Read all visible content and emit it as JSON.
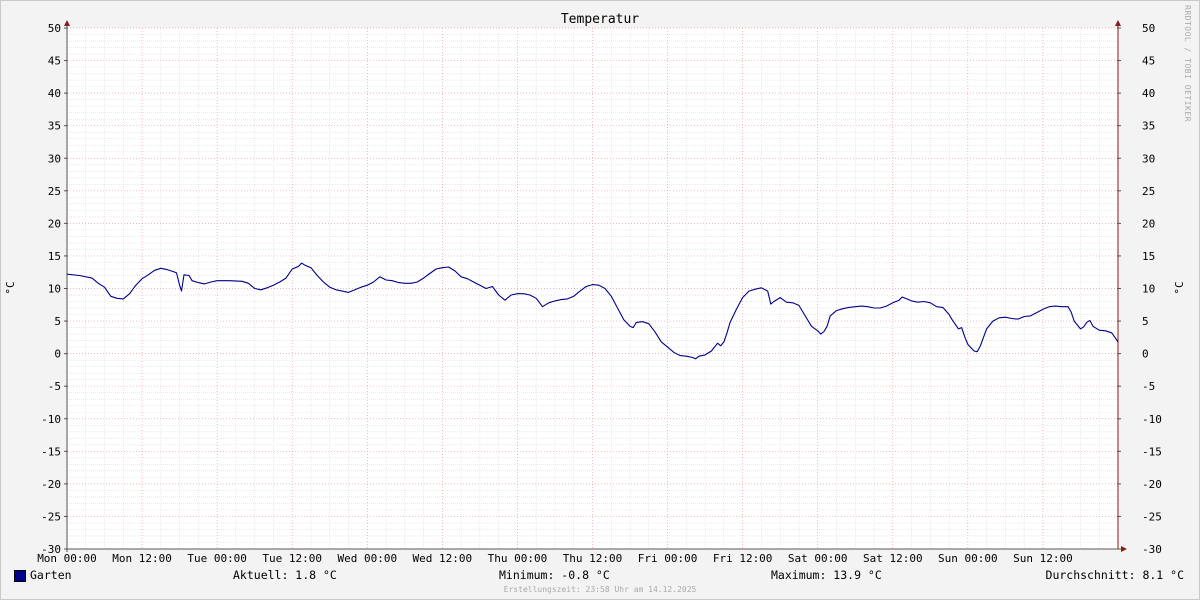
{
  "chart_data": {
    "type": "line",
    "title": "Temperatur",
    "ylabel": "°C",
    "ylabel_right": "°C",
    "ylim": [
      -30,
      50
    ],
    "yticks": [
      50,
      45,
      40,
      35,
      30,
      25,
      20,
      15,
      10,
      5,
      0,
      -5,
      -10,
      -15,
      -20,
      -25,
      -30
    ],
    "xlim": [
      0,
      168
    ],
    "x_unit": "hours since Mon 00:00",
    "xticks": [
      {
        "x": 0,
        "label": "Mon 00:00"
      },
      {
        "x": 12,
        "label": "Mon 12:00"
      },
      {
        "x": 24,
        "label": "Tue 00:00"
      },
      {
        "x": 36,
        "label": "Tue 12:00"
      },
      {
        "x": 48,
        "label": "Wed 00:00"
      },
      {
        "x": 60,
        "label": "Wed 12:00"
      },
      {
        "x": 72,
        "label": "Thu 00:00"
      },
      {
        "x": 84,
        "label": "Thu 12:00"
      },
      {
        "x": 96,
        "label": "Fri 00:00"
      },
      {
        "x": 108,
        "label": "Fri 12:00"
      },
      {
        "x": 120,
        "label": "Sat 00:00"
      },
      {
        "x": 132,
        "label": "Sat 12:00"
      },
      {
        "x": 144,
        "label": "Sun 00:00"
      },
      {
        "x": 156,
        "label": "Sun 12:00"
      }
    ],
    "grid": true,
    "legend_position": "bottom-left",
    "series": [
      {
        "name": "Garten",
        "color": "#00008b",
        "points": [
          [
            0,
            12.2
          ],
          [
            2,
            12.0
          ],
          [
            4,
            11.6
          ],
          [
            5,
            10.8
          ],
          [
            6,
            10.2
          ],
          [
            6.5,
            9.5
          ],
          [
            7,
            8.8
          ],
          [
            8,
            8.5
          ],
          [
            9,
            8.4
          ],
          [
            10,
            9.2
          ],
          [
            11,
            10.5
          ],
          [
            12,
            11.5
          ],
          [
            13,
            12.1
          ],
          [
            14,
            12.8
          ],
          [
            15,
            13.1
          ],
          [
            16,
            12.9
          ],
          [
            17,
            12.6
          ],
          [
            17.5,
            12.4
          ],
          [
            18,
            10.5
          ],
          [
            18.3,
            9.6
          ],
          [
            18.7,
            12.1
          ],
          [
            19.5,
            12.0
          ],
          [
            20,
            11.2
          ],
          [
            21,
            10.9
          ],
          [
            22,
            10.7
          ],
          [
            23,
            11.0
          ],
          [
            24,
            11.2
          ],
          [
            26,
            11.2
          ],
          [
            28,
            11.1
          ],
          [
            29,
            10.8
          ],
          [
            30,
            10.0
          ],
          [
            31,
            9.8
          ],
          [
            32,
            10.1
          ],
          [
            33,
            10.5
          ],
          [
            34,
            11.0
          ],
          [
            35,
            11.6
          ],
          [
            36,
            13.0
          ],
          [
            37,
            13.4
          ],
          [
            37.5,
            13.9
          ],
          [
            38,
            13.6
          ],
          [
            39,
            13.2
          ],
          [
            40,
            12.0
          ],
          [
            41,
            11.0
          ],
          [
            42,
            10.2
          ],
          [
            43,
            9.8
          ],
          [
            44,
            9.6
          ],
          [
            45,
            9.4
          ],
          [
            46,
            9.8
          ],
          [
            47,
            10.2
          ],
          [
            48,
            10.5
          ],
          [
            49,
            11.0
          ],
          [
            50,
            11.8
          ],
          [
            51,
            11.3
          ],
          [
            52,
            11.2
          ],
          [
            53,
            10.9
          ],
          [
            54,
            10.8
          ],
          [
            55,
            10.8
          ],
          [
            56,
            11.0
          ],
          [
            57,
            11.6
          ],
          [
            58,
            12.3
          ],
          [
            59,
            13.0
          ],
          [
            60,
            13.2
          ],
          [
            61,
            13.3
          ],
          [
            62,
            12.7
          ],
          [
            63,
            11.8
          ],
          [
            64,
            11.5
          ],
          [
            65,
            11.0
          ],
          [
            66,
            10.5
          ],
          [
            67,
            10.0
          ],
          [
            68,
            10.3
          ],
          [
            69,
            9.0
          ],
          [
            70,
            8.2
          ],
          [
            71,
            9.0
          ],
          [
            72,
            9.2
          ],
          [
            73,
            9.2
          ],
          [
            74,
            9.0
          ],
          [
            75,
            8.5
          ],
          [
            76,
            7.2
          ],
          [
            77,
            7.8
          ],
          [
            78,
            8.1
          ],
          [
            79,
            8.3
          ],
          [
            80,
            8.4
          ],
          [
            81,
            8.8
          ],
          [
            82,
            9.6
          ],
          [
            83,
            10.3
          ],
          [
            84,
            10.6
          ],
          [
            85,
            10.5
          ],
          [
            86,
            10.0
          ],
          [
            87,
            8.8
          ],
          [
            88,
            7.0
          ],
          [
            89,
            5.2
          ],
          [
            90,
            4.2
          ],
          [
            90.5,
            4.0
          ],
          [
            91,
            4.8
          ],
          [
            92,
            4.9
          ],
          [
            93,
            4.6
          ],
          [
            94,
            3.3
          ],
          [
            95,
            1.8
          ],
          [
            96,
            1.0
          ],
          [
            97,
            0.2
          ],
          [
            98,
            -0.3
          ],
          [
            99,
            -0.4
          ],
          [
            100,
            -0.6
          ],
          [
            100.5,
            -0.8
          ],
          [
            101,
            -0.4
          ],
          [
            102,
            -0.2
          ],
          [
            103,
            0.4
          ],
          [
            104,
            1.6
          ],
          [
            104.5,
            1.2
          ],
          [
            105,
            1.8
          ],
          [
            105.5,
            3.2
          ],
          [
            106,
            4.8
          ],
          [
            107,
            6.8
          ],
          [
            108,
            8.6
          ],
          [
            109,
            9.6
          ],
          [
            110,
            9.9
          ],
          [
            111,
            10.1
          ],
          [
            112,
            9.6
          ],
          [
            112.5,
            7.6
          ],
          [
            113,
            8.0
          ],
          [
            114,
            8.6
          ],
          [
            115,
            7.9
          ],
          [
            116,
            7.8
          ],
          [
            117,
            7.4
          ],
          [
            118,
            5.8
          ],
          [
            119,
            4.2
          ],
          [
            120,
            3.5
          ],
          [
            120.5,
            3.0
          ],
          [
            121,
            3.4
          ],
          [
            121.5,
            4.2
          ],
          [
            122,
            5.8
          ],
          [
            123,
            6.6
          ],
          [
            124,
            6.9
          ],
          [
            125,
            7.1
          ],
          [
            126,
            7.2
          ],
          [
            127,
            7.3
          ],
          [
            128,
            7.2
          ],
          [
            129,
            7.0
          ],
          [
            130,
            7.0
          ],
          [
            131,
            7.3
          ],
          [
            132,
            7.8
          ],
          [
            133,
            8.2
          ],
          [
            133.5,
            8.7
          ],
          [
            134,
            8.5
          ],
          [
            135,
            8.1
          ],
          [
            136,
            7.9
          ],
          [
            137,
            8.0
          ],
          [
            138,
            7.8
          ],
          [
            139,
            7.2
          ],
          [
            140,
            7.1
          ],
          [
            141,
            6.0
          ],
          [
            141.5,
            5.2
          ],
          [
            142,
            4.5
          ],
          [
            142.5,
            3.8
          ],
          [
            143,
            4.0
          ],
          [
            143.5,
            2.6
          ],
          [
            144,
            1.4
          ],
          [
            145,
            0.4
          ],
          [
            145.5,
            0.3
          ],
          [
            146,
            1.2
          ],
          [
            146.5,
            2.5
          ],
          [
            147,
            3.8
          ],
          [
            148,
            5.0
          ],
          [
            149,
            5.5
          ],
          [
            150,
            5.6
          ],
          [
            151,
            5.4
          ],
          [
            152,
            5.3
          ],
          [
            153,
            5.7
          ],
          [
            154,
            5.8
          ],
          [
            155,
            6.3
          ],
          [
            156,
            6.8
          ],
          [
            157,
            7.2
          ],
          [
            158,
            7.3
          ],
          [
            159,
            7.2
          ],
          [
            160,
            7.2
          ],
          [
            160.5,
            6.4
          ],
          [
            161,
            5.0
          ],
          [
            162,
            3.8
          ],
          [
            162.5,
            4.1
          ],
          [
            163,
            4.8
          ],
          [
            163.5,
            5.1
          ],
          [
            164,
            4.2
          ],
          [
            165,
            3.6
          ],
          [
            166,
            3.5
          ],
          [
            167,
            3.2
          ],
          [
            167.5,
            2.5
          ],
          [
            168,
            1.8
          ]
        ]
      }
    ]
  },
  "legend": {
    "series_name": "Garten",
    "current": "Aktuell: 1.8 °C",
    "minimum": "Minimum: -0.8 °C",
    "maximum": "Maximum: 13.9 °C",
    "average": "Durchschnitt: 8.1 °C"
  },
  "footer": {
    "created": "Erstellungszeit: 23:58 Uhr am 14.12.2025",
    "watermark": "RRDTOOL / TOBI OETIKER"
  }
}
